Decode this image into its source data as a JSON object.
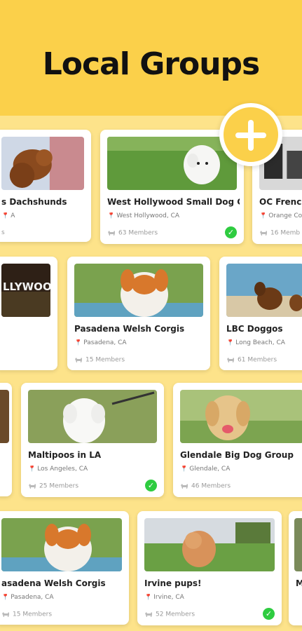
{
  "title": "Local Groups",
  "cards": [
    {
      "name": "s Dachshunds",
      "location": "A",
      "members": "s",
      "check": false
    },
    {
      "name": "West Hollywood Small Dog G...",
      "location": "West Hollywood, CA",
      "members": "63 Members",
      "check": true
    },
    {
      "name": "OC French",
      "location": "Orange Co",
      "members": "16 Memb",
      "check": false
    },
    {
      "name": "",
      "location": "",
      "members": "",
      "check": false
    },
    {
      "name": "Pasadena Welsh Corgis",
      "location": "Pasadena, CA",
      "members": "15 Members",
      "check": false
    },
    {
      "name": "LBC Doggos",
      "location": "Long Beach, CA",
      "members": "61 Members",
      "check": false
    },
    {
      "name": "",
      "location": "",
      "members": "",
      "check": false
    },
    {
      "name": "Maltipoos in LA",
      "location": "Los Angeles, CA",
      "members": "25 Members",
      "check": true
    },
    {
      "name": "Glendale Big Dog Group",
      "location": "Glendale, CA",
      "members": "46 Members",
      "check": false
    },
    {
      "name": "asadena Welsh Corgis",
      "location": "Pasadena, CA",
      "members": "15 Members",
      "check": false
    },
    {
      "name": "Irvine pups!",
      "location": "Irvine, CA",
      "members": "52 Members",
      "check": true
    },
    {
      "name": "M",
      "location": "",
      "members": "",
      "check": false
    }
  ],
  "photo_text": {
    "hollywood": "LLYWOOD"
  },
  "colors": {
    "background": "#fbd04a",
    "board": "#fde38a",
    "check": "#2ecc40",
    "pin": "#e23b3b"
  },
  "icons": {
    "add": "plus-icon",
    "check": "check-icon",
    "location": "pin-icon",
    "members": "dog-icon"
  }
}
